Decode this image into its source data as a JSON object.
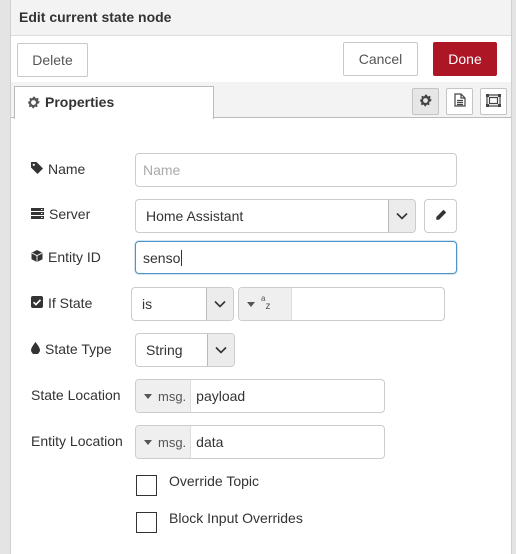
{
  "dialog": {
    "title": "Edit current state node",
    "delete_label": "Delete",
    "cancel_label": "Cancel",
    "done_label": "Done"
  },
  "tabs": {
    "properties_label": "Properties",
    "icons": [
      "gear-icon",
      "description-icon",
      "appearance-icon"
    ]
  },
  "form": {
    "name": {
      "label": "Name",
      "value": "",
      "placeholder": "Name"
    },
    "server": {
      "label": "Server",
      "value": "Home Assistant"
    },
    "entity_id": {
      "label": "Entity ID",
      "value": "senso"
    },
    "if_state": {
      "label": "If State",
      "operator": "is",
      "type_glyph_a": "a",
      "type_glyph_z": "z",
      "value": ""
    },
    "state_type": {
      "label": "State Type",
      "value": "String"
    },
    "state_location": {
      "label": "State Location",
      "prefix": "msg.",
      "value": "payload"
    },
    "entity_location": {
      "label": "Entity Location",
      "prefix": "msg.",
      "value": "data"
    },
    "override_topic": {
      "label": "Override Topic",
      "checked": false
    },
    "block_input_overrides": {
      "label": "Block Input Overrides",
      "checked": false
    }
  },
  "colors": {
    "primary": "#ad1625",
    "focus": "#4d94c8"
  }
}
